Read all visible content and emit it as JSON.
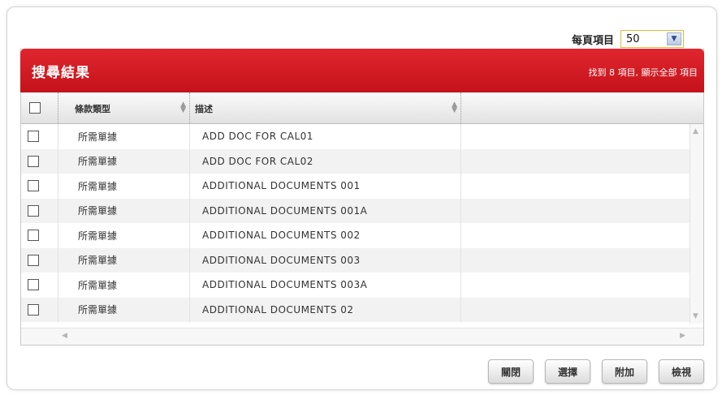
{
  "per_page": {
    "label": "每頁項目",
    "value": "50",
    "arrow_icon": "chevron-down-icon"
  },
  "results": {
    "title": "搜尋結果",
    "count_text": "找到 8 項目, 顯示全部 項目",
    "header_color": "#d21a22",
    "columns": {
      "type": "條款類型",
      "description": "描述"
    },
    "rows": [
      {
        "type": "所需單據",
        "description": "ADD DOC FOR CAL01"
      },
      {
        "type": "所需單據",
        "description": "ADD DOC FOR CAL02"
      },
      {
        "type": "所需單據",
        "description": "ADDITIONAL DOCUMENTS 001"
      },
      {
        "type": "所需單據",
        "description": "ADDITIONAL DOCUMENTS 001A"
      },
      {
        "type": "所需單據",
        "description": "ADDITIONAL DOCUMENTS 002"
      },
      {
        "type": "所需單據",
        "description": "ADDITIONAL DOCUMENTS 003"
      },
      {
        "type": "所需單據",
        "description": "ADDITIONAL DOCUMENTS 003A"
      },
      {
        "type": "所需單據",
        "description": "ADDITIONAL DOCUMENTS 02"
      }
    ]
  },
  "actions": {
    "close": "關閉",
    "select": "選擇",
    "add": "附加",
    "view": "檢視"
  }
}
